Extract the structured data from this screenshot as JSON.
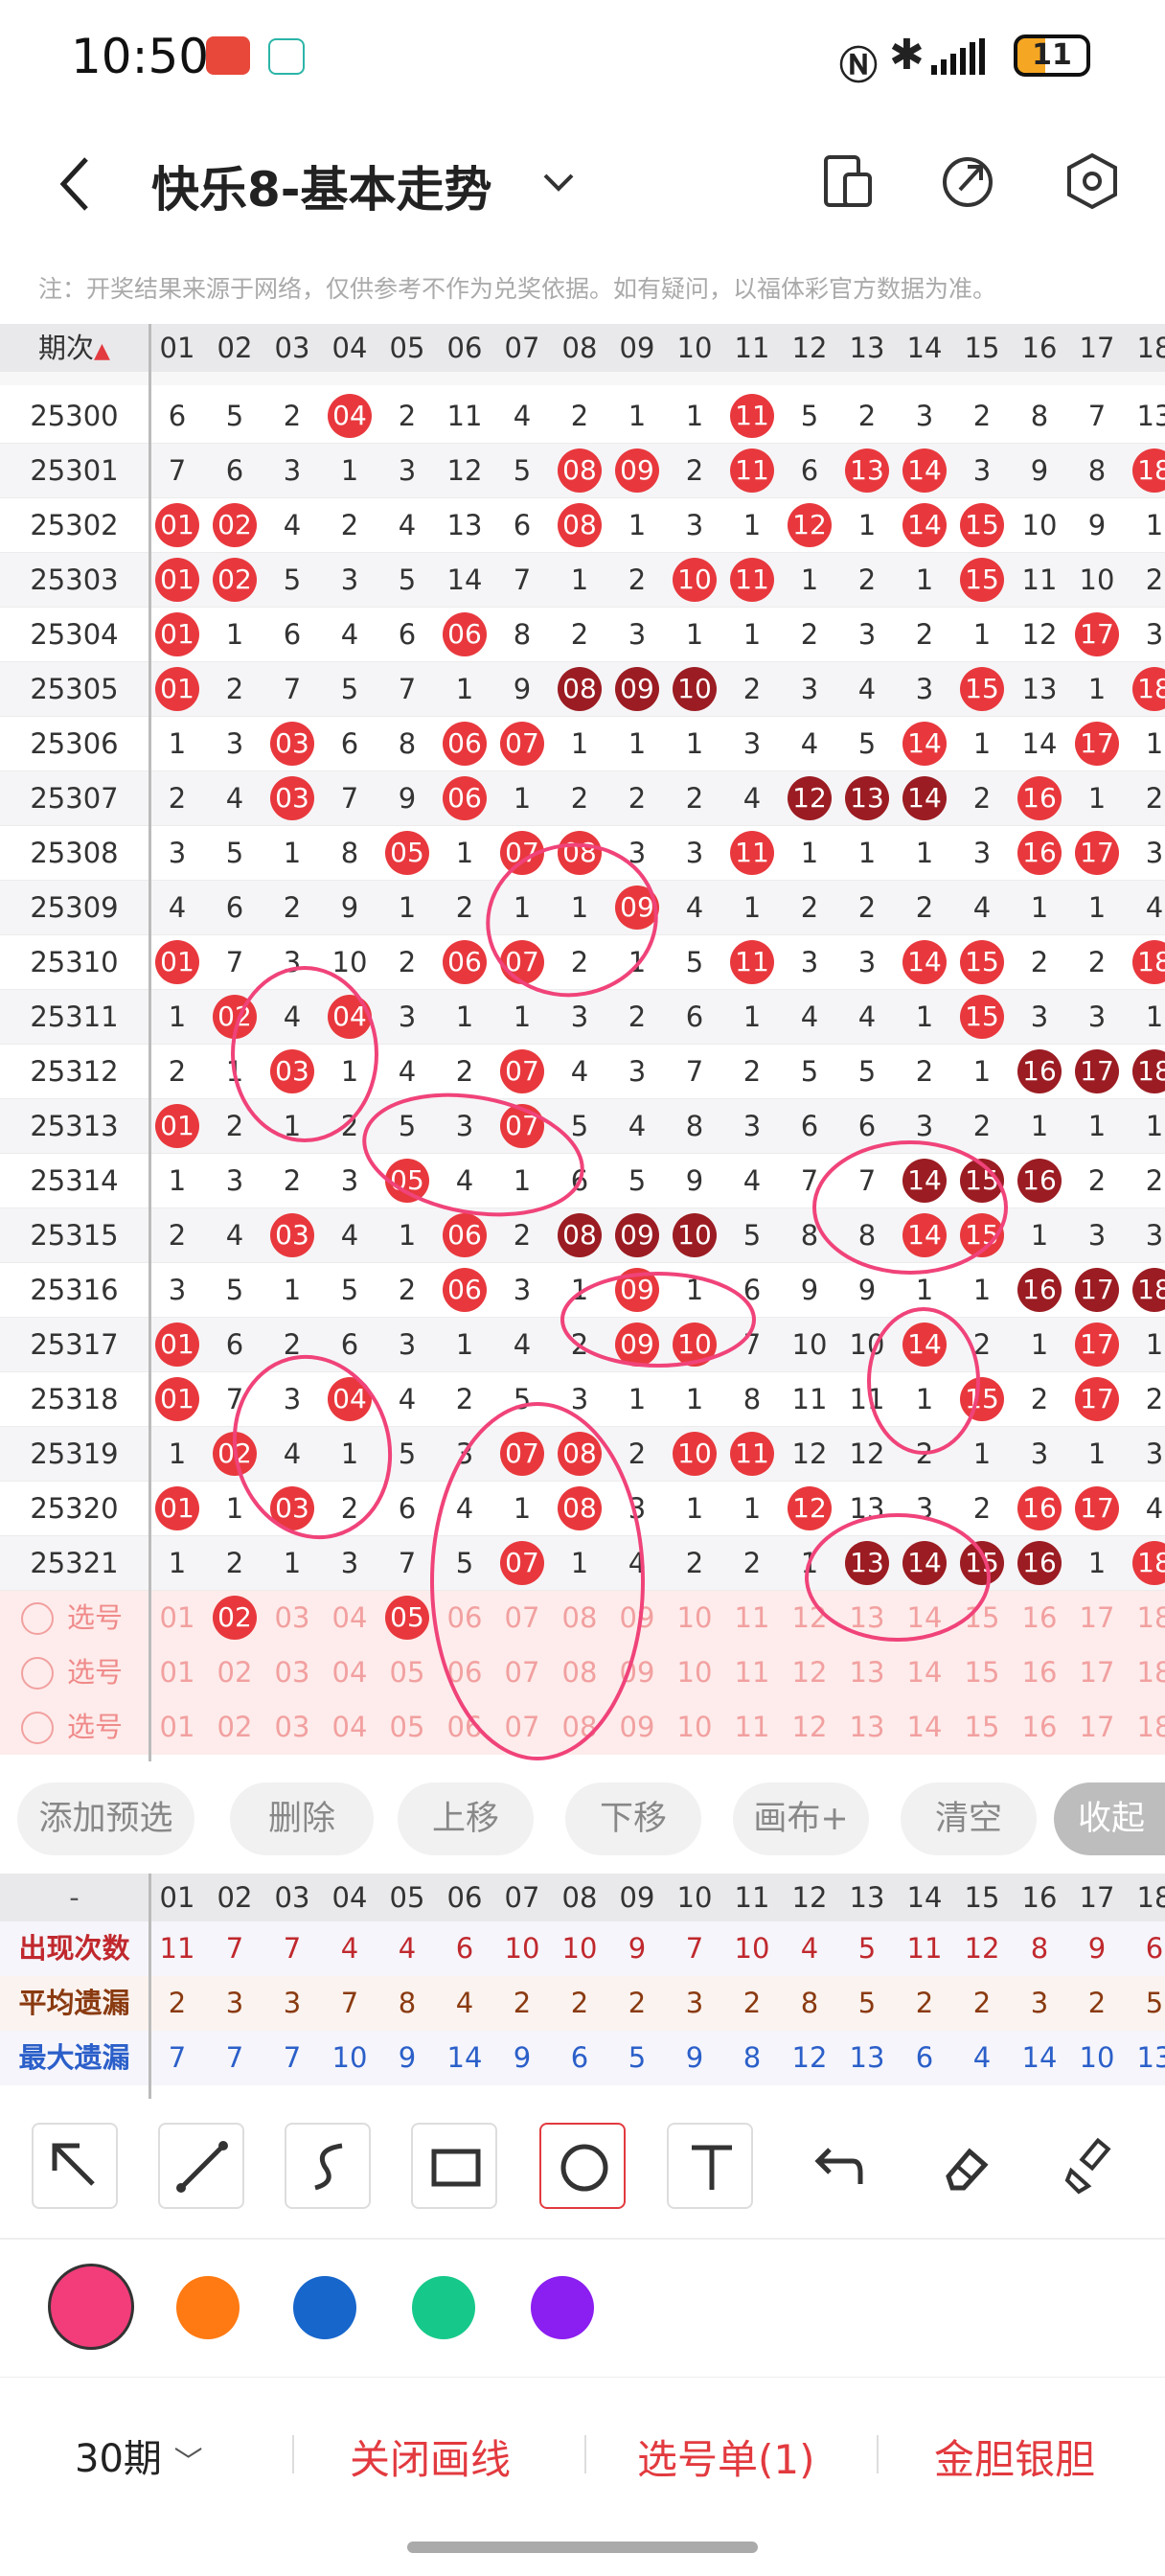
{
  "status": {
    "time": "10:50",
    "battery": "11"
  },
  "header": {
    "title": "快乐8-基本走势"
  },
  "note": "注：开奖结果来源于网络，仅供参考不作为兑奖依据。如有疑问，以福体彩官方数据为准。",
  "grid": {
    "period_header": "期次",
    "columns": [
      "01",
      "02",
      "03",
      "04",
      "05",
      "06",
      "07",
      "08",
      "09",
      "10",
      "11",
      "12",
      "13",
      "14",
      "15",
      "16",
      "17",
      "18"
    ],
    "rows": [
      {
        "period": "25300",
        "cells": [
          "6",
          "5",
          "2",
          "04",
          "2",
          "11",
          "4",
          "2",
          "1",
          "1",
          "11",
          "5",
          "2",
          "3",
          "2",
          "8",
          "7",
          "13"
        ],
        "balls": [
          3,
          10
        ]
      },
      {
        "period": "25301",
        "cells": [
          "7",
          "6",
          "3",
          "1",
          "3",
          "12",
          "5",
          "08",
          "09",
          "2",
          "11",
          "6",
          "13",
          "14",
          "3",
          "9",
          "8",
          "18"
        ],
        "balls": [
          7,
          8,
          10,
          12,
          13,
          17
        ]
      },
      {
        "period": "25302",
        "cells": [
          "01",
          "02",
          "4",
          "2",
          "4",
          "13",
          "6",
          "08",
          "1",
          "3",
          "1",
          "12",
          "1",
          "14",
          "15",
          "10",
          "9",
          "1"
        ],
        "balls": [
          0,
          1,
          7,
          11,
          13,
          14
        ]
      },
      {
        "period": "25303",
        "cells": [
          "01",
          "02",
          "5",
          "3",
          "5",
          "14",
          "7",
          "1",
          "2",
          "10",
          "11",
          "1",
          "2",
          "1",
          "15",
          "11",
          "10",
          "2"
        ],
        "balls": [
          0,
          1,
          9,
          10,
          14
        ]
      },
      {
        "period": "25304",
        "cells": [
          "01",
          "1",
          "6",
          "4",
          "6",
          "06",
          "8",
          "2",
          "3",
          "1",
          "1",
          "2",
          "3",
          "2",
          "1",
          "12",
          "17",
          "3"
        ],
        "balls": [
          0,
          5,
          16
        ]
      },
      {
        "period": "25305",
        "cells": [
          "01",
          "2",
          "7",
          "5",
          "7",
          "1",
          "9",
          "08",
          "09",
          "10",
          "2",
          "3",
          "4",
          "3",
          "15",
          "13",
          "1",
          "18"
        ],
        "balls": [
          0,
          7,
          8,
          9,
          14,
          17
        ],
        "dark": [
          7,
          8,
          9
        ]
      },
      {
        "period": "25306",
        "cells": [
          "1",
          "3",
          "03",
          "6",
          "8",
          "06",
          "07",
          "1",
          "1",
          "1",
          "3",
          "4",
          "5",
          "14",
          "1",
          "14",
          "17",
          "1"
        ],
        "balls": [
          2,
          5,
          6,
          13,
          16
        ]
      },
      {
        "period": "25307",
        "cells": [
          "2",
          "4",
          "03",
          "7",
          "9",
          "06",
          "1",
          "2",
          "2",
          "2",
          "4",
          "12",
          "13",
          "14",
          "2",
          "16",
          "1",
          "2"
        ],
        "balls": [
          2,
          5,
          11,
          12,
          13,
          15
        ],
        "dark": [
          11,
          12,
          13
        ]
      },
      {
        "period": "25308",
        "cells": [
          "3",
          "5",
          "1",
          "8",
          "05",
          "1",
          "07",
          "08",
          "3",
          "3",
          "11",
          "1",
          "1",
          "1",
          "3",
          "16",
          "17",
          "3"
        ],
        "balls": [
          4,
          6,
          7,
          10,
          15,
          16
        ]
      },
      {
        "period": "25309",
        "cells": [
          "4",
          "6",
          "2",
          "9",
          "1",
          "2",
          "1",
          "1",
          "09",
          "4",
          "1",
          "2",
          "2",
          "2",
          "4",
          "1",
          "1",
          "4"
        ],
        "balls": [
          8
        ]
      },
      {
        "period": "25310",
        "cells": [
          "01",
          "7",
          "3",
          "10",
          "2",
          "06",
          "07",
          "2",
          "1",
          "5",
          "11",
          "3",
          "3",
          "14",
          "15",
          "2",
          "2",
          "18"
        ],
        "balls": [
          0,
          5,
          6,
          10,
          13,
          14,
          17
        ]
      },
      {
        "period": "25311",
        "cells": [
          "1",
          "02",
          "4",
          "04",
          "3",
          "1",
          "1",
          "3",
          "2",
          "6",
          "1",
          "4",
          "4",
          "1",
          "15",
          "3",
          "3",
          "1"
        ],
        "balls": [
          1,
          3,
          14
        ]
      },
      {
        "period": "25312",
        "cells": [
          "2",
          "1",
          "03",
          "1",
          "4",
          "2",
          "07",
          "4",
          "3",
          "7",
          "2",
          "5",
          "5",
          "2",
          "1",
          "16",
          "17",
          "18"
        ],
        "balls": [
          2,
          6,
          15,
          16,
          17
        ],
        "dark": [
          15,
          16,
          17
        ]
      },
      {
        "period": "25313",
        "cells": [
          "01",
          "2",
          "1",
          "2",
          "5",
          "3",
          "07",
          "5",
          "4",
          "8",
          "3",
          "6",
          "6",
          "3",
          "2",
          "1",
          "1",
          "1"
        ],
        "balls": [
          0,
          6
        ]
      },
      {
        "period": "25314",
        "cells": [
          "1",
          "3",
          "2",
          "3",
          "05",
          "4",
          "1",
          "6",
          "5",
          "9",
          "4",
          "7",
          "7",
          "14",
          "15",
          "16",
          "2",
          "2"
        ],
        "balls": [
          4,
          13,
          14,
          15
        ],
        "dark": [
          13,
          14,
          15
        ]
      },
      {
        "period": "25315",
        "cells": [
          "2",
          "4",
          "03",
          "4",
          "1",
          "06",
          "2",
          "08",
          "09",
          "10",
          "5",
          "8",
          "8",
          "14",
          "15",
          "1",
          "3",
          "3"
        ],
        "balls": [
          2,
          5,
          7,
          8,
          9,
          13,
          14
        ],
        "dark": [
          7,
          8,
          9
        ]
      },
      {
        "period": "25316",
        "cells": [
          "3",
          "5",
          "1",
          "5",
          "2",
          "06",
          "3",
          "1",
          "09",
          "1",
          "6",
          "9",
          "9",
          "1",
          "1",
          "16",
          "17",
          "18"
        ],
        "balls": [
          5,
          8,
          15,
          16,
          17
        ],
        "dark": [
          15,
          16,
          17
        ]
      },
      {
        "period": "25317",
        "cells": [
          "01",
          "6",
          "2",
          "6",
          "3",
          "1",
          "4",
          "2",
          "09",
          "10",
          "7",
          "10",
          "10",
          "14",
          "2",
          "1",
          "17",
          "1"
        ],
        "balls": [
          0,
          8,
          9,
          13,
          16
        ]
      },
      {
        "period": "25318",
        "cells": [
          "01",
          "7",
          "3",
          "04",
          "4",
          "2",
          "5",
          "3",
          "1",
          "1",
          "8",
          "11",
          "11",
          "1",
          "15",
          "2",
          "17",
          "2"
        ],
        "balls": [
          0,
          3,
          14,
          16
        ]
      },
      {
        "period": "25319",
        "cells": [
          "1",
          "02",
          "4",
          "1",
          "5",
          "3",
          "07",
          "08",
          "2",
          "10",
          "11",
          "12",
          "12",
          "2",
          "1",
          "3",
          "1",
          "3"
        ],
        "balls": [
          1,
          6,
          7,
          9,
          10
        ]
      },
      {
        "period": "25320",
        "cells": [
          "01",
          "1",
          "03",
          "2",
          "6",
          "4",
          "1",
          "08",
          "3",
          "1",
          "1",
          "12",
          "13",
          "3",
          "2",
          "16",
          "17",
          "4"
        ],
        "balls": [
          0,
          2,
          7,
          11,
          15,
          16
        ]
      },
      {
        "period": "25321",
        "cells": [
          "1",
          "2",
          "1",
          "3",
          "7",
          "5",
          "07",
          "1",
          "4",
          "2",
          "2",
          "1",
          "13",
          "14",
          "15",
          "16",
          "1",
          "18"
        ],
        "balls": [
          6,
          12,
          13,
          14,
          15,
          17
        ],
        "dark": [
          12,
          13,
          14,
          15
        ]
      }
    ],
    "select_rows": [
      {
        "label": "选号",
        "balls": [
          1,
          4
        ]
      },
      {
        "label": "选号",
        "balls": []
      },
      {
        "label": "选号",
        "balls": []
      }
    ]
  },
  "actions": [
    "添加预选",
    "删除",
    "上移",
    "下移",
    "画布+",
    "清空",
    "收起"
  ],
  "stats": {
    "dash": "-",
    "rows": [
      {
        "label": "出现次数",
        "color": "#c0282d",
        "values": [
          "11",
          "7",
          "7",
          "4",
          "4",
          "6",
          "10",
          "10",
          "9",
          "7",
          "10",
          "4",
          "5",
          "11",
          "12",
          "8",
          "9",
          "6"
        ]
      },
      {
        "label": "平均遗漏",
        "color": "#8a3a10",
        "values": [
          "2",
          "3",
          "3",
          "7",
          "8",
          "4",
          "2",
          "2",
          "2",
          "3",
          "2",
          "8",
          "5",
          "2",
          "2",
          "3",
          "2",
          "5"
        ]
      },
      {
        "label": "最大遗漏",
        "color": "#2b5fc9",
        "values": [
          "7",
          "7",
          "7",
          "10",
          "9",
          "14",
          "9",
          "6",
          "5",
          "9",
          "8",
          "12",
          "13",
          "6",
          "4",
          "14",
          "10",
          "13"
        ]
      }
    ]
  },
  "tools": [
    "arrow-tool-icon",
    "line-tool-icon",
    "curve-tool-icon",
    "rect-tool-icon",
    "circle-tool-icon",
    "text-tool-icon",
    "undo-icon",
    "eraser-icon",
    "brush-clear-icon"
  ],
  "colors": [
    "#f23d7a",
    "#ff7a12",
    "#1766cc",
    "#16c98a",
    "#8b1ef0"
  ],
  "bottom": {
    "period_select": "30期",
    "close_lines": "关闭画线",
    "number_list": "选号单(1)",
    "gold_silver": "金胆银胆"
  }
}
